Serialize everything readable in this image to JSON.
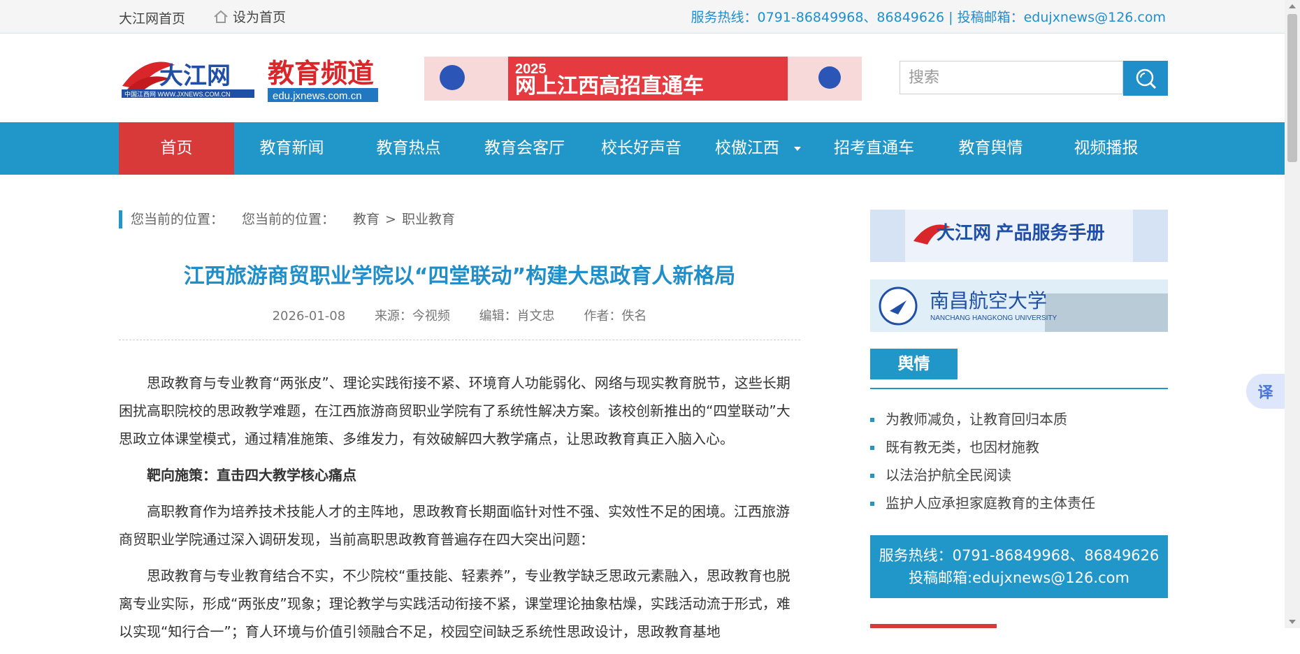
{
  "topbar": {
    "home_link": "大江网首页",
    "set_home": "设为首页",
    "contact": "服务热线：0791-86849968、86849626 | 投稿邮箱：edujxnews@126.com"
  },
  "header": {
    "logo_text_1": "大江网",
    "logo_sub_1": "中国江西网 WWW.JXNEWS.COM.CN",
    "logo_text_2": "教育频道",
    "logo_sub_2": "edu.jxnews.com.cn",
    "banner_year": "2025",
    "banner_text": "网上江西高招直通车",
    "search_placeholder": "搜索"
  },
  "nav": {
    "items": [
      {
        "label": "首页"
      },
      {
        "label": "教育新闻"
      },
      {
        "label": "教育热点"
      },
      {
        "label": "教育会客厅"
      },
      {
        "label": "校长好声音"
      },
      {
        "label": "校傲江西"
      },
      {
        "label": "招考直通车"
      },
      {
        "label": "教育舆情"
      },
      {
        "label": "视频播报"
      }
    ]
  },
  "breadcrumb": {
    "label": "您当前的位置：",
    "label2": "您当前的位置：",
    "path1": "教育",
    "sep": ">",
    "path2": "职业教育"
  },
  "article": {
    "title": "江西旅游商贸职业学院以“四堂联动”构建大思政育人新格局",
    "date": "2026-01-08",
    "source": "来源：今视频",
    "editor": "编辑：肖文忠",
    "author": "作者：佚名",
    "paragraphs": [
      "思政教育与专业教育“两张皮”、理论实践衔接不紧、环境育人功能弱化、网络与现实教育脱节，这些长期困扰高职院校的思政教学难题，在江西旅游商贸职业学院有了系统性解决方案。该校创新推出的“四堂联动”大思政立体课堂模式，通过精准施策、多维发力，有效破解四大教学痛点，让思政教育真正入脑入心。",
      "靶向施策：直击四大教学核心痛点",
      "高职教育作为培养技术技能人才的主阵地，思政教育长期面临针对性不强、实效性不足的困境。江西旅游商贸职业学院通过深入调研发现，当前高职思政教育普遍存在四大突出问题：",
      "思政教育与专业教育结合不实，不少院校“重技能、轻素养”，专业教学缺乏思政元素融入，思政教育也脱离专业实际，形成“两张皮”现象；理论教学与实践活动衔接不紧，课堂理论抽象枯燥，实践活动流于形式，难以实现“知行合一”；育人环境与价值引领融合不足，校园空间缺乏系统性思政设计，思政教育基地"
    ]
  },
  "sidebar": {
    "ad1_text": "大江网 产品服务手册",
    "ad2_text": "南昌航空大学",
    "ad2_sub": "NANCHANG HANGKONG UNIVERSITY",
    "yuqing_title": "舆情",
    "yuqing_items": [
      "为教师减负，让教育回归本质",
      "既有教无类，也因材施教",
      "以法治护航全民阅读",
      "监护人应承担家庭教育的主体责任"
    ],
    "service_line1": "服务热线：0791-86849968、86849626",
    "service_line2": "投稿邮箱:edujxnews@126.com"
  },
  "translate_label": "译",
  "colors": {
    "primary": "#2196c9",
    "active_nav": "#d83a3a",
    "title_blue": "#1f8ec9"
  }
}
